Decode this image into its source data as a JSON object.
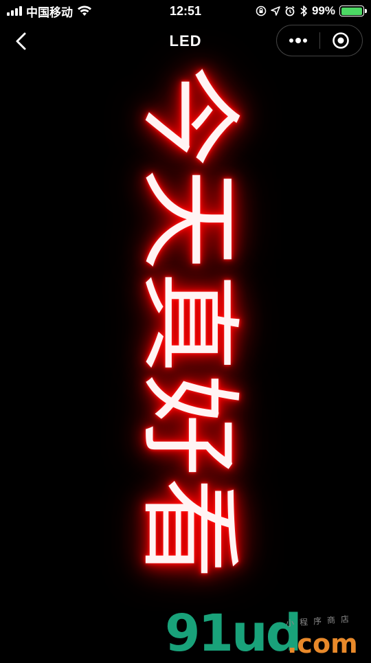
{
  "status_bar": {
    "carrier": "中国移动",
    "time": "12:51",
    "battery_percent": "99%",
    "battery_level": 0.99,
    "battery_color": "#4cd964"
  },
  "nav": {
    "title": "LED",
    "back_icon": "chevron-left-icon",
    "more_icon": "more-dots-icon",
    "close_icon": "target-circle-icon"
  },
  "led": {
    "text": "今天真好看",
    "glow_color": "#ff0000",
    "orientation": "rotated-90deg"
  },
  "watermark": {
    "main": "91ud",
    "tld": ".com",
    "tagline": "小程序商店"
  }
}
